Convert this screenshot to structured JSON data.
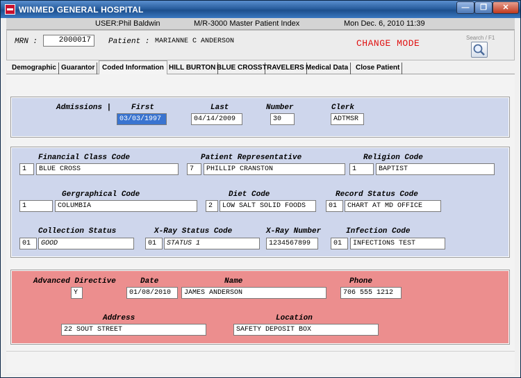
{
  "window": {
    "title": "WINMED GENERAL HOSPITAL"
  },
  "userbar": {
    "user": "USER:Phil Baldwin",
    "module": "M/R-3000   Master Patient Index",
    "datetime": "Mon Dec.  6, 2010 11:39"
  },
  "header": {
    "mrn_label": "MRN :",
    "mrn_value": "2000017",
    "patient_label": "Patient :",
    "patient_name": "MARIANNE C ANDERSON",
    "mode": "CHANGE MODE",
    "search_label": "Search / F1"
  },
  "tabs": [
    {
      "label": "Demographic"
    },
    {
      "label": "Guarantor"
    },
    {
      "label": "Coded Information"
    },
    {
      "label": "HILL BURTON"
    },
    {
      "label": "BLUE CROSS"
    },
    {
      "label": "TRAVELERS"
    },
    {
      "label": "Medical Data"
    },
    {
      "label": "Close Patient"
    }
  ],
  "admissions": {
    "label": "Admissions |",
    "first_label": "First",
    "first_value": "03/03/1997",
    "last_label": "Last",
    "last_value": "04/14/2009",
    "number_label": "Number",
    "number_value": "30",
    "clerk_label": "Clerk",
    "clerk_value": "ADTMSR"
  },
  "codes": {
    "financial_label": "Financial Class Code",
    "financial_code": "1",
    "financial_desc": "BLUE CROSS",
    "rep_label": "Patient Representative",
    "rep_code": "7",
    "rep_desc": "PHILLIP CRANSTON",
    "religion_label": "Religion Code",
    "religion_code": "1",
    "religion_desc": "BAPTIST",
    "geo_label": "Gergraphical Code",
    "geo_code": "1",
    "geo_desc": "COLUMBIA",
    "diet_label": "Diet Code",
    "diet_code": "2",
    "diet_desc": "LOW SALT SOLID FOODS",
    "record_label": "Record Status Code",
    "record_code": "01",
    "record_desc": "CHART AT MD OFFICE",
    "collection_label": "Collection Status",
    "collection_code": "01",
    "collection_desc": "GOOD",
    "xray_status_label": "X-Ray Status Code",
    "xray_status_code": "01",
    "xray_status_desc": "STATUS 1",
    "xray_number_label": "X-Ray Number",
    "xray_number_value": "1234567899",
    "infection_label": "Infection Code",
    "infection_code": "01",
    "infection_desc": "INFECTIONS TEST"
  },
  "directive": {
    "adv_label": "Advanced Directive",
    "adv_value": "Y",
    "date_label": "Date",
    "date_value": "01/08/2010",
    "name_label": "Name",
    "name_value": "JAMES ANDERSON",
    "phone_label": "Phone",
    "phone_value": "706 555 1212",
    "address_label": "Address",
    "address_value": "22 SOUT STREET",
    "location_label": "Location",
    "location_value": "SAFETY DEPOSIT BOX"
  },
  "colors": {
    "blue_panel": "#ced6ec",
    "red_panel": "#ec8e8e",
    "mode_red": "#e01010"
  }
}
